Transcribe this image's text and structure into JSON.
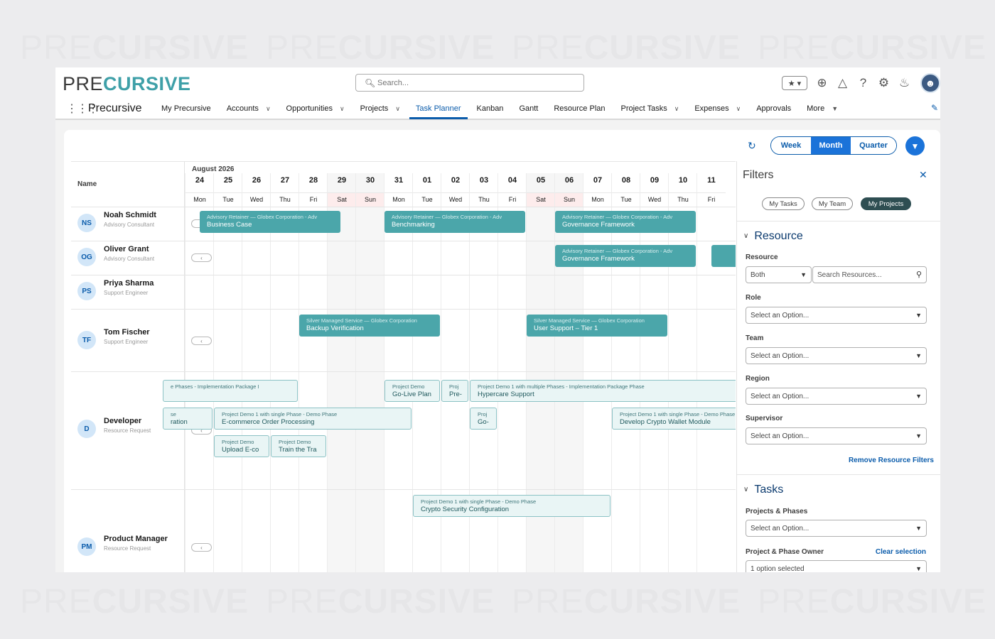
{
  "watermark": {
    "light": "PRE",
    "bold": "CURSIVE"
  },
  "header": {
    "logo_light": "PRE",
    "logo_bold": "CURSIVE",
    "search_placeholder": "Search...",
    "icons": [
      "favorites-star-icon",
      "add-icon",
      "trailhead-icon",
      "help-icon",
      "gear-icon",
      "bell-icon",
      "user-avatar-icon"
    ]
  },
  "nav": {
    "app_name": "Precursive",
    "items": [
      {
        "label": "My Precursive",
        "dropdown": false,
        "active": false
      },
      {
        "label": "Accounts",
        "dropdown": true,
        "active": false
      },
      {
        "label": "Opportunities",
        "dropdown": true,
        "active": false
      },
      {
        "label": "Projects",
        "dropdown": true,
        "active": false
      },
      {
        "label": "Task Planner",
        "dropdown": false,
        "active": true
      },
      {
        "label": "Kanban",
        "dropdown": false,
        "active": false
      },
      {
        "label": "Gantt",
        "dropdown": false,
        "active": false
      },
      {
        "label": "Resource Plan",
        "dropdown": false,
        "active": false
      },
      {
        "label": "Project Tasks",
        "dropdown": true,
        "active": false
      },
      {
        "label": "Expenses",
        "dropdown": true,
        "active": false
      },
      {
        "label": "Approvals",
        "dropdown": false,
        "active": false
      },
      {
        "label": "More",
        "dropdown": true,
        "active": false
      }
    ]
  },
  "toolbar": {
    "views": [
      {
        "label": "Week",
        "active": false
      },
      {
        "label": "Month",
        "active": true
      },
      {
        "label": "Quarter",
        "active": false
      }
    ]
  },
  "planner": {
    "name_header": "Name",
    "month_label": "August 2026",
    "days": [
      {
        "num": "24",
        "name": "Mon",
        "weekend": false
      },
      {
        "num": "25",
        "name": "Tue",
        "weekend": false
      },
      {
        "num": "26",
        "name": "Wed",
        "weekend": false
      },
      {
        "num": "27",
        "name": "Thu",
        "weekend": false
      },
      {
        "num": "28",
        "name": "Fri",
        "weekend": false
      },
      {
        "num": "29",
        "name": "Sat",
        "weekend": true
      },
      {
        "num": "30",
        "name": "Sun",
        "weekend": true
      },
      {
        "num": "31",
        "name": "Mon",
        "weekend": false
      },
      {
        "num": "01",
        "name": "Tue",
        "weekend": false
      },
      {
        "num": "02",
        "name": "Wed",
        "weekend": false
      },
      {
        "num": "03",
        "name": "Thu",
        "weekend": false
      },
      {
        "num": "04",
        "name": "Fri",
        "weekend": false
      },
      {
        "num": "05",
        "name": "Sat",
        "weekend": true
      },
      {
        "num": "06",
        "name": "Sun",
        "weekend": true
      },
      {
        "num": "07",
        "name": "Mon",
        "weekend": false
      },
      {
        "num": "08",
        "name": "Tue",
        "weekend": false
      },
      {
        "num": "09",
        "name": "Wed",
        "weekend": false
      },
      {
        "num": "10",
        "name": "Thu",
        "weekend": false
      },
      {
        "num": "11",
        "name": "Fri",
        "weekend": false
      }
    ],
    "resources": [
      {
        "initials": "NS",
        "name": "Noah Schmidt",
        "role": "Advisory Consultant"
      },
      {
        "initials": "OG",
        "name": "Oliver Grant",
        "role": "Advisory Consultant"
      },
      {
        "initials": "PS",
        "name": "Priya Sharma",
        "role": "Support Engineer"
      },
      {
        "initials": "TF",
        "name": "Tom Fischer",
        "role": "Support Engineer"
      },
      {
        "initials": "D",
        "name": "Developer",
        "role": "Resource Request"
      },
      {
        "initials": "PM",
        "name": "Product Manager",
        "role": "Resource Request"
      }
    ],
    "tasks": [
      {
        "row": 0,
        "start": 0.5,
        "span": 5,
        "style": "solid",
        "project": "Advisory Retainer — Globex Corporation - Adv",
        "title": "Business Case"
      },
      {
        "row": 0,
        "start": 7,
        "span": 5,
        "style": "solid",
        "project": "Advisory Retainer — Globex Corporation - Adv",
        "title": "Benchmarking"
      },
      {
        "row": 0,
        "start": 13,
        "span": 5,
        "style": "solid",
        "project": "Advisory Retainer — Globex Corporation - Adv",
        "title": "Governance Framework"
      },
      {
        "row": 1,
        "start": 13,
        "span": 5,
        "style": "solid",
        "project": "Advisory Retainer — Globex Corporation - Adv",
        "title": "Governance Framework"
      },
      {
        "row": 1,
        "start": 18.5,
        "span": 1,
        "style": "solid",
        "project": "",
        "title": ""
      },
      {
        "row": 3,
        "start": 4,
        "span": 5,
        "style": "solid",
        "project": "Silver Managed Service — Globex Corporation",
        "title": "Backup Verification"
      },
      {
        "row": 3,
        "start": 12,
        "span": 5,
        "style": "solid",
        "project": "Silver Managed Service — Globex Corporation",
        "title": "User Support – Tier 1"
      },
      {
        "row": 4,
        "start": -0.8,
        "span": 4.8,
        "style": "light",
        "project": "e Phases - Implementation Package I",
        "title": "",
        "lane": 0
      },
      {
        "row": 4,
        "start": 7,
        "span": 2,
        "style": "light",
        "project": "Project Demo",
        "title": "Go-Live Plan",
        "lane": 0
      },
      {
        "row": 4,
        "start": 9,
        "span": 1,
        "style": "light",
        "project": "Proj",
        "title": "Pre-",
        "lane": 0
      },
      {
        "row": 4,
        "start": 10,
        "span": 9.5,
        "style": "light",
        "project": "Project Demo 1 with multiple Phases - Implementation Package Phase",
        "title": "Hypercare Support",
        "lane": 0
      },
      {
        "row": 4,
        "start": -0.8,
        "span": 1.8,
        "style": "light",
        "project": "se",
        "title": "ration",
        "lane": 1
      },
      {
        "row": 4,
        "start": 1,
        "span": 7,
        "style": "light",
        "project": "Project Demo 1 with single Phase - Demo Phase",
        "title": "E-commerce Order Processing",
        "lane": 1
      },
      {
        "row": 4,
        "start": 10,
        "span": 1,
        "style": "light",
        "project": "Proj",
        "title": "Go-",
        "lane": 1
      },
      {
        "row": 4,
        "start": 15,
        "span": 4.5,
        "style": "light",
        "project": "Project Demo 1 with single Phase - Demo Phase",
        "title": "Develop Crypto Wallet Module",
        "lane": 1
      },
      {
        "row": 4,
        "start": 1,
        "span": 2,
        "style": "light",
        "project": "Project Demo",
        "title": "Upload E-co",
        "lane": 2
      },
      {
        "row": 4,
        "start": 3,
        "span": 2,
        "style": "light",
        "project": "Project Demo",
        "title": "Train the Tra",
        "lane": 2
      },
      {
        "row": 5,
        "start": 8,
        "span": 7,
        "style": "light",
        "project": "Project Demo 1 with single Phase - Demo Phase",
        "title": "Crypto Security Configuration",
        "lane": 0
      }
    ]
  },
  "filters": {
    "title": "Filters",
    "pills": [
      {
        "label": "My Tasks",
        "active": false
      },
      {
        "label": "My Team",
        "active": false
      },
      {
        "label": "My Projects",
        "active": true
      }
    ],
    "resource_section": "Resource",
    "resource_label": "Resource",
    "resource_type": "Both",
    "resource_search_placeholder": "Search Resources...",
    "role_label": "Role",
    "team_label": "Team",
    "region_label": "Region",
    "supervisor_label": "Supervisor",
    "select_placeholder": "Select an Option...",
    "remove_resource_filters": "Remove Resource Filters",
    "tasks_section": "Tasks",
    "projects_label": "Projects & Phases",
    "owner_label": "Project & Phase Owner",
    "clear_selection": "Clear selection",
    "owner_value": "1 option selected"
  }
}
